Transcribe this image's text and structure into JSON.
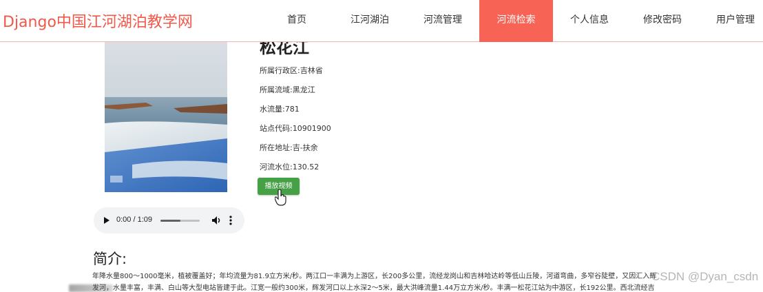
{
  "brand": {
    "title": "Django中国江河湖泊教学网",
    "color": "#f0584a"
  },
  "nav": {
    "items": [
      {
        "label": "首页",
        "active": false
      },
      {
        "label": "江河湖泊",
        "active": false
      },
      {
        "label": "河流管理",
        "active": false
      },
      {
        "label": "河流检索",
        "active": true
      },
      {
        "label": "个人信息",
        "active": false
      },
      {
        "label": "修改密码",
        "active": false
      },
      {
        "label": "用户管理",
        "active": false
      }
    ],
    "active_color": "#f76456"
  },
  "river": {
    "name": "松花江",
    "fields": [
      "所属行政区:吉林省",
      "所属流域:黑龙江",
      "水流量:781",
      "站点代码:10901900",
      "所在地址:吉-扶余",
      "河流水位:130.52"
    ],
    "play_button": "播放视频",
    "button_color": "#46a046"
  },
  "audio": {
    "time": "0:00 / 1:09",
    "progress": 0.5
  },
  "intro": {
    "heading": "简介:",
    "lines": [
      "年降水量800～1000毫米，植被覆盖好；年均流量为81.9立方米/秒。两江口一丰满为上游区，长200多公里，流经龙岗山和吉林哈达岭等低山丘陵，河道弯曲，多窄谷陡壁，又因汇入辉",
      "发河，水量丰富，丰满、白山等大型电站皆建于此。江宽一般约300米，辉发河口以上水深2～5米，最大洪峰流量1.44万立方米/秒。丰满一松花江站为中游区，长192公里。西北流经吉"
    ]
  },
  "watermark": "CSDN @Dyan_csdn"
}
